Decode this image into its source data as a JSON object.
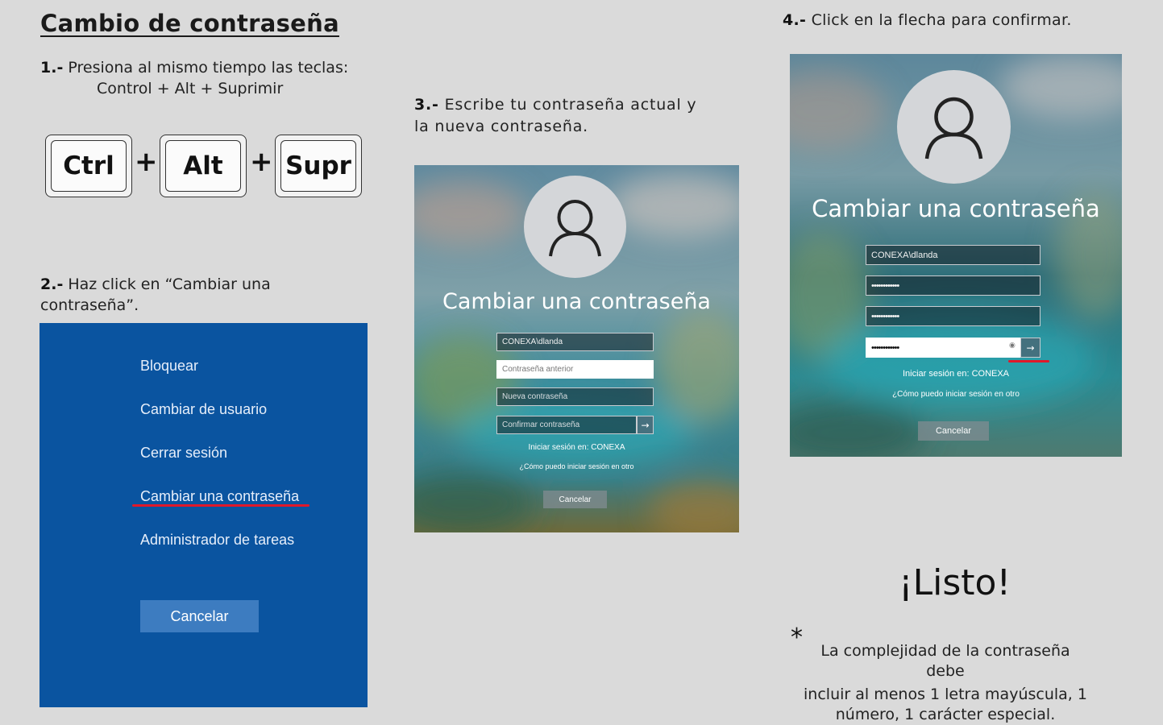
{
  "title": "Cambio de  contraseña",
  "step1": {
    "num": "1.-",
    "text": "Presiona al mismo tiempo las teclas:",
    "keys_line": "Control +  Alt + Suprimir",
    "keys": [
      "Ctrl",
      "Alt",
      "Supr"
    ],
    "plus": "+"
  },
  "step2": {
    "num": "2.-",
    "text_a": "Haz click en “Cambiar una",
    "text_b": "contraseña”.",
    "menu": {
      "items": [
        "Bloquear",
        "Cambiar de usuario",
        "Cerrar sesión",
        "Cambiar una contraseña",
        "Administrador de tareas"
      ],
      "cancel": "Cancelar"
    }
  },
  "step3": {
    "num": "3.-",
    "text_a": "Escribe tu contraseña actual y",
    "text_b": "la nueva contraseña.",
    "screen": {
      "heading": "Cambiar una contraseña",
      "user": "CONEXA\\dlanda",
      "old_placeholder": "Contraseña anterior",
      "new_placeholder": "Nueva contraseña",
      "confirm_placeholder": "Confirmar contraseña",
      "signin": "Iniciar sesión en: CONEXA",
      "howto": "¿Cómo puedo iniciar sesión en otro",
      "cancel": "Cancelar"
    }
  },
  "step4": {
    "num": "4.-",
    "text": "Click en la flecha para confirmar.",
    "screen": {
      "heading": "Cambiar una contraseña",
      "user": "CONEXA\\dlanda",
      "masked": "••••••••••••",
      "signin": "Iniciar sesión en: CONEXA",
      "howto": "¿Cómo puedo iniciar sesión en otro",
      "cancel": "Cancelar"
    }
  },
  "done": "¡Listo!",
  "note": {
    "star": "*",
    "line1": "La complejidad de la contraseña debe",
    "line2": "incluir al menos 1 letra mayúscula, 1",
    "line3": "número, 1 carácter especial."
  },
  "colors": {
    "page_bg": "#dadada",
    "menu_bg": "#0a54a0",
    "highlight": "#e0182a"
  }
}
